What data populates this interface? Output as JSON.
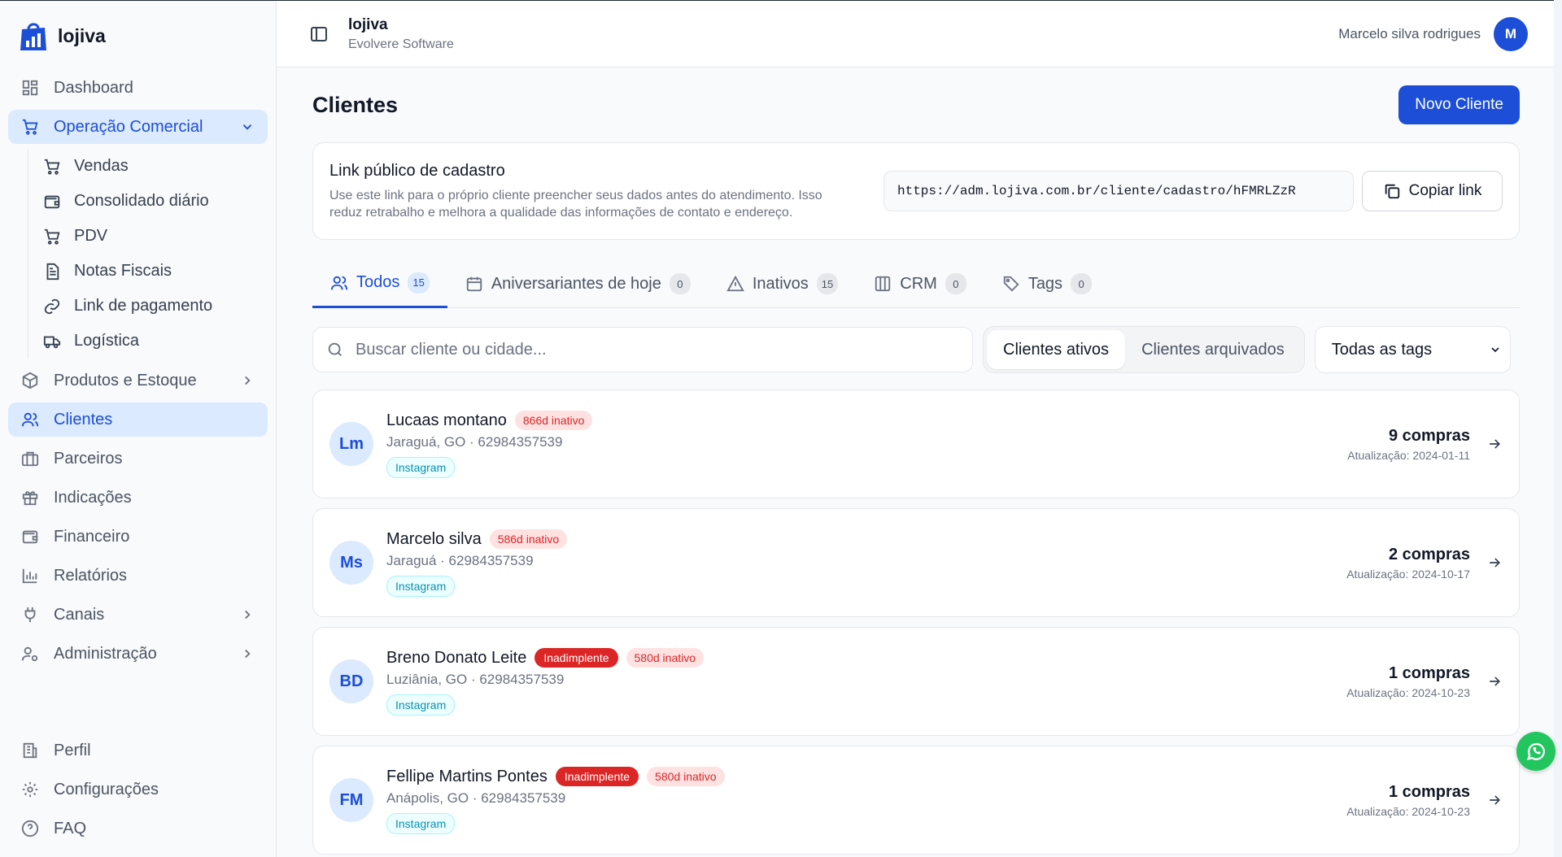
{
  "brand": {
    "name": "lojiva"
  },
  "sidebar": {
    "items": [
      {
        "label": "Dashboard",
        "icon": "dashboard-icon"
      },
      {
        "label": "Operação Comercial",
        "icon": "cart-icon",
        "expanded": true
      },
      {
        "label": "Produtos e Estoque",
        "icon": "box-icon"
      },
      {
        "label": "Clientes",
        "icon": "users-icon",
        "active": true
      },
      {
        "label": "Parceiros",
        "icon": "briefcase-icon"
      },
      {
        "label": "Indicações",
        "icon": "gift-icon"
      },
      {
        "label": "Financeiro",
        "icon": "wallet-icon"
      },
      {
        "label": "Relatórios",
        "icon": "bar-chart-icon"
      },
      {
        "label": "Canais",
        "icon": "plug-icon"
      },
      {
        "label": "Administração",
        "icon": "user-cog-icon"
      }
    ],
    "subitems": [
      {
        "label": "Vendas",
        "icon": "cart-icon"
      },
      {
        "label": "Consolidado diário",
        "icon": "wallet-icon"
      },
      {
        "label": "PDV",
        "icon": "cart-icon"
      },
      {
        "label": "Notas Fiscais",
        "icon": "document-icon"
      },
      {
        "label": "Link de pagamento",
        "icon": "link-icon"
      },
      {
        "label": "Logística",
        "icon": "truck-icon"
      }
    ],
    "bottom": [
      {
        "label": "Perfil",
        "icon": "building-icon"
      },
      {
        "label": "Configurações",
        "icon": "gear-icon"
      },
      {
        "label": "FAQ",
        "icon": "help-circle-icon"
      }
    ]
  },
  "topbar": {
    "title": "lojiva",
    "subtitle": "Evolvere Software",
    "user_name": "Marcelo silva rodrigues",
    "user_initial": "M"
  },
  "page": {
    "title": "Clientes",
    "new_button": "Novo Cliente"
  },
  "public_link": {
    "title": "Link público de cadastro",
    "description": "Use este link para o próprio cliente preencher seus dados antes do atendimento. Isso reduz retrabalho e melhora a qualidade das informações de contato e endereço.",
    "url": "https://adm.lojiva.com.br/cliente/cadastro/hFMRLZzR",
    "copy_button": "Copiar link"
  },
  "tabs": [
    {
      "label": "Todos",
      "count": "15",
      "icon": "users-icon",
      "active": true
    },
    {
      "label": "Aniversariantes de hoje",
      "count": "0",
      "icon": "calendar-icon"
    },
    {
      "label": "Inativos",
      "count": "15",
      "icon": "alert-triangle-icon"
    },
    {
      "label": "CRM",
      "count": "0",
      "icon": "columns-icon"
    },
    {
      "label": "Tags",
      "count": "0",
      "icon": "tag-icon"
    }
  ],
  "filters": {
    "search_placeholder": "Buscar cliente ou cidade...",
    "segment_active": "Clientes ativos",
    "segment_archived": "Clientes arquivados",
    "tags_select": "Todas as tags"
  },
  "clients": [
    {
      "initials": "Lm",
      "name": "Lucaas montano",
      "badges": [],
      "inactive": "866d inativo",
      "meta": "Jaraguá, GO · 62984357539",
      "tag": "Instagram",
      "purchases": "9 compras",
      "updated": "Atualização: 2024-01-11"
    },
    {
      "initials": "Ms",
      "name": "Marcelo silva",
      "badges": [],
      "inactive": "586d inativo",
      "meta": "Jaraguá · 62984357539",
      "tag": "Instagram",
      "purchases": "2 compras",
      "updated": "Atualização: 2024-10-17"
    },
    {
      "initials": "BD",
      "name": "Breno Donato Leite",
      "badges": [
        "Inadimplente"
      ],
      "inactive": "580d inativo",
      "meta": "Luziânia, GO · 62984357539",
      "tag": "Instagram",
      "purchases": "1 compras",
      "updated": "Atualização: 2024-10-23"
    },
    {
      "initials": "FM",
      "name": "Fellipe Martins Pontes",
      "badges": [
        "Inadimplente"
      ],
      "inactive": "580d inativo",
      "meta": "Anápolis, GO · 62984357539",
      "tag": "Instagram",
      "purchases": "1 compras",
      "updated": "Atualização: 2024-10-23"
    }
  ],
  "colors": {
    "primary": "#1d4ed8",
    "danger": "#dc2626",
    "whatsapp": "#22c55e"
  }
}
